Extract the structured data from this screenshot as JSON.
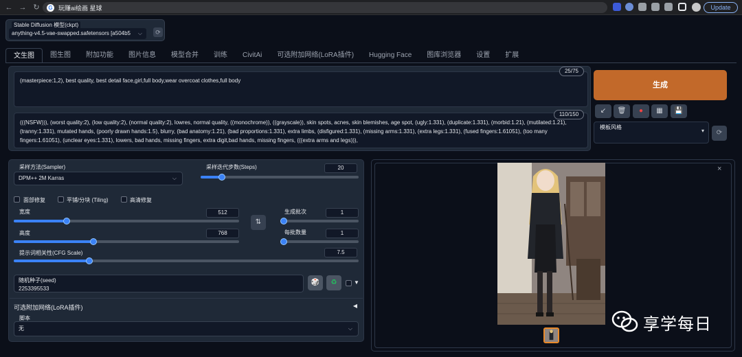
{
  "browser": {
    "url_title": "玩赚ai绘画 星球",
    "update_label": "Update",
    "google_glyph": "G",
    "nav_icons": [
      "back-icon",
      "forward-icon",
      "reload-icon"
    ],
    "back_glyph": "←",
    "forward_glyph": "→",
    "reload_glyph": "↻"
  },
  "model": {
    "label": "Stable Diffusion 模型(ckpt)",
    "value": "anything-v4.5-vae-swapped.safetensors [a504b5",
    "chevron_glyph": "⌵",
    "refresh_glyph": "⟳"
  },
  "tabs": [
    "文生图",
    "图生图",
    "附加功能",
    "图片信息",
    "模型合并",
    "训练",
    "CivitAi",
    "可选附加网络(LoRA插件)",
    "Hugging Face",
    "图库浏览器",
    "设置",
    "扩展"
  ],
  "prompt": {
    "positive": "(masterpiece:1,2), best quality, best detail face,girl,full body,wear overcoat clothes,full body",
    "positive_count": "25/75",
    "negative": "(((NSFW))), (worst quality:2), (low quality:2), (normal quality:2), lowres, normal quality, ((monochrome)), ((grayscale)), skin spots, acnes, skin blemishes, age spot, (ugly:1.331), (duplicate:1.331), (morbid:1.21), (mutilated:1.21), (tranny:1.331), mutated hands, (poorly drawn hands:1.5), blurry, (bad anatomy:1.21), (bad proportions:1.331), extra limbs, (disfigured:1.331), (missing arms:1.331), (extra legs:1.331), (fused fingers:1.61051), (too many fingers:1.61051), (unclear eyes:1.331), lowers, bad hands, missing fingers, extra digit,bad hands, missing fingers, (((extra arms and legs))),",
    "negative_count": "110/150"
  },
  "actions": {
    "generate_label": "生成",
    "style_label": "模板风格",
    "style_arrow": "▾",
    "refresh_glyph": "⟳",
    "tool_glyphs": [
      "↙",
      "🗑",
      "●",
      "▦",
      "💾"
    ]
  },
  "settings": {
    "sampler_label": "采样方法(Sampler)",
    "sampler_value": "DPM++ 2M Karras",
    "steps_label": "采样迭代步数(Steps)",
    "steps_value": "20",
    "steps_fraction": 0.133,
    "face_fix": "面部修复",
    "tiling": "平铺/分块 (Tiling)",
    "hires_fix": "高清修复",
    "width_label": "宽度",
    "width_value": "512",
    "width_fraction": 0.235,
    "height_label": "高度",
    "height_value": "768",
    "height_fraction": 0.353,
    "swap_glyph": "⇅",
    "batch_count_label": "生成批次",
    "batch_count_value": "1",
    "batch_count_fraction": 0.0,
    "batch_size_label": "每批数量",
    "batch_size_value": "1",
    "batch_size_fraction": 0.0,
    "cfg_label": "提示词相关性(CFG Scale)",
    "cfg_value": "7.5",
    "cfg_fraction": 0.22,
    "seed_label": "随机种子(seed)",
    "seed_value": "2253395533",
    "dice_glyph": "🎲",
    "recycle_glyph": "♻",
    "extra_glyph": "▼",
    "lora_label": "可选附加网络(LoRA插件)",
    "lora_collapse_glyph": "◀",
    "script_label": "脚本",
    "script_value": "无",
    "chevron_glyph": "⌵"
  },
  "output": {
    "close_glyph": "×",
    "watermark": "享学每日"
  },
  "colors": {
    "accent": "#c2692a",
    "slider": "#3b82f6",
    "background": "#0b0f19",
    "panel": "#1f2937"
  }
}
